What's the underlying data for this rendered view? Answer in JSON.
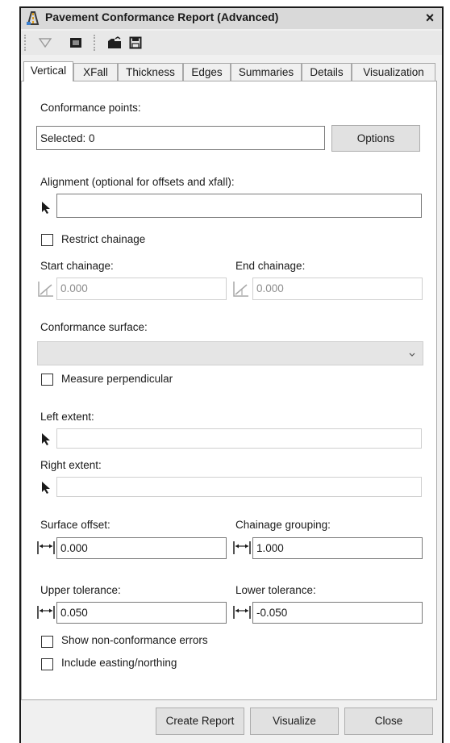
{
  "window": {
    "title": "Pavement Conformance Report (Advanced)",
    "close": "×"
  },
  "tabs": [
    {
      "label": "Vertical"
    },
    {
      "label": "XFall"
    },
    {
      "label": "Thickness"
    },
    {
      "label": "Edges"
    },
    {
      "label": "Summaries"
    },
    {
      "label": "Details"
    },
    {
      "label": "Visualization"
    }
  ],
  "active_tab": "Vertical",
  "form": {
    "conformance_points_label": "Conformance points:",
    "selected_value": "Selected: 0",
    "options_button": "Options",
    "alignment_label": "Alignment (optional for offsets and xfall):",
    "alignment_value": "",
    "restrict_chainage": "Restrict chainage",
    "start_chainage_label": "Start chainage:",
    "start_chainage_value": "0.000",
    "end_chainage_label": "End chainage:",
    "end_chainage_value": "0.000",
    "conformance_surface_label": "Conformance surface:",
    "conformance_surface_value": "",
    "measure_perpendicular": "Measure perpendicular",
    "left_extent_label": "Left extent:",
    "left_extent_value": "",
    "right_extent_label": "Right extent:",
    "right_extent_value": "",
    "surface_offset_label": "Surface offset:",
    "surface_offset_value": "0.000",
    "chainage_grouping_label": "Chainage grouping:",
    "chainage_grouping_value": "1.000",
    "upper_tolerance_label": "Upper tolerance:",
    "upper_tolerance_value": "0.050",
    "lower_tolerance_label": "Lower tolerance:",
    "lower_tolerance_value": "-0.050",
    "show_errors": "Show non-conformance errors",
    "include_easting": "Include easting/northing"
  },
  "buttons": {
    "create_report": "Create Report",
    "visualize": "Visualize",
    "close": "Close"
  }
}
